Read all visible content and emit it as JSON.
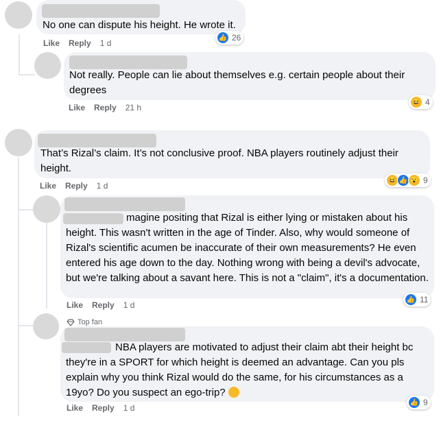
{
  "comments": [
    {
      "text": "No one can dispute his height. He wrote it.",
      "like": "Like",
      "reply": "Reply",
      "time": "1 d",
      "reaction_count": "26"
    },
    {
      "text": "Not really. People can lie about themselves e.g. certain people about their degrees",
      "like": "Like",
      "reply": "Reply",
      "time": "21 h",
      "reaction_count": "4"
    },
    {
      "text": "That’s Rizal’s claim. It’s not conclusive proof. NBA players routinely adjust their height.",
      "like": "Like",
      "reply": "Reply",
      "time": "1 d",
      "reaction_count": "9"
    },
    {
      "text": "magine positing that Rizal is either lying or mistaken about his height. This wasn't written in the age of Tinder. Also, why would someone of Rizal's scientific acumen be inaccurate of their own measurements? He even entered his age down to the day. Nothing wrong with being a devil's advocate, but we're talking about a savant here. This is not a \"claim\", it's a documentation.",
      "like": "Like",
      "reply": "Reply",
      "time": "1 d",
      "reaction_count": "11"
    },
    {
      "badge": "Top fan",
      "text": "NBA players are motivated to adjust their claim abt their height bc they're in a SPORT for which height is deemed an advantage. Can you pls explain why you think Rizal would do the same, for his circumstances as a 19yo? Do you suspect an ego-trip?",
      "like": "Like",
      "reply": "Reply",
      "time": "1 d",
      "reaction_count": "9"
    }
  ],
  "icons": {
    "like_reaction": "like-reaction-icon",
    "haha_reaction": "haha-reaction-icon",
    "wow_reaction": "wow-reaction-icon",
    "top_fan": "diamond-icon",
    "thinking_emoji": "thinking-emoji-icon"
  },
  "colors": {
    "like_blue": "#1877f2",
    "emoji_yellow": "#f7b928",
    "bubble": "#f0f2f5",
    "meta_gray": "#65676b"
  }
}
